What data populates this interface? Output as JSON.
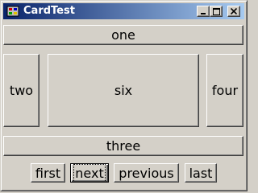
{
  "window": {
    "title": "CardTest",
    "controls": {
      "minimize": "minimize-icon",
      "maximize": "maximize-icon",
      "close": "close-icon"
    }
  },
  "layout_buttons": {
    "north": "one",
    "west": "two",
    "center": "six",
    "east": "four",
    "south": "three"
  },
  "nav_buttons": {
    "first": "first",
    "next": "next",
    "previous": "previous",
    "last": "last"
  },
  "focused_button": "next",
  "colors": {
    "face": "#d4d0c8",
    "titlebar_start": "#0a246a",
    "titlebar_end": "#a6caf0"
  }
}
